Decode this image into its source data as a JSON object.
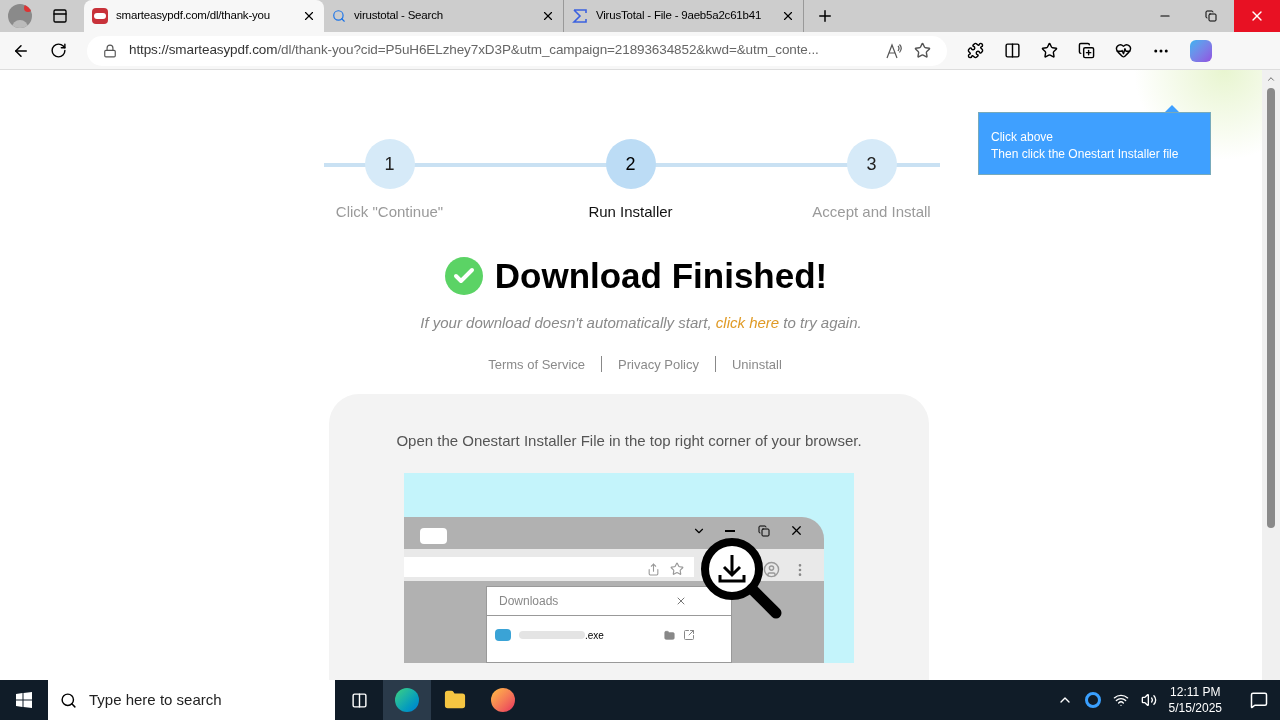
{
  "browser": {
    "tabs": [
      {
        "title": "smarteasypdf.com/dl/thank-you",
        "selected": true
      },
      {
        "title": "virustotal - Search",
        "selected": false
      },
      {
        "title": "VirusTotal - File - 9aeb5a2c61b41",
        "selected": false
      }
    ],
    "address_bar": {
      "url_host": "https://smarteasypdf.com",
      "url_rest": "/dl/thank-you?cid=P5uH6ELzhey7xD3P&utm_campaign=21893634852&kwd=&utm_conte..."
    }
  },
  "page": {
    "steps": [
      {
        "number": "1",
        "label": "Click \"Continue\"",
        "selected": false
      },
      {
        "number": "2",
        "label": "Run Installer",
        "selected": true
      },
      {
        "number": "3",
        "label": "Accept and Install",
        "selected": false
      }
    ],
    "heading": "Download Finished!",
    "note_before": "If your download doesn't automatically start,",
    "note_link": "click here",
    "note_after": "to try again.",
    "footer_links": [
      "Terms of Service",
      "Privacy Policy",
      "Uninstall"
    ],
    "card": {
      "instruction": "Open the Onestart Installer File in the top right corner of your browser.",
      "downloads_title": "Downloads",
      "file_name": ".exe"
    },
    "tooltip": [
      "Click above",
      "Then click the Onestart Installer file"
    ]
  },
  "taskbar": {
    "search_placeholder": "Type here to search",
    "time": "12:11 PM",
    "date": "5/15/2025"
  }
}
